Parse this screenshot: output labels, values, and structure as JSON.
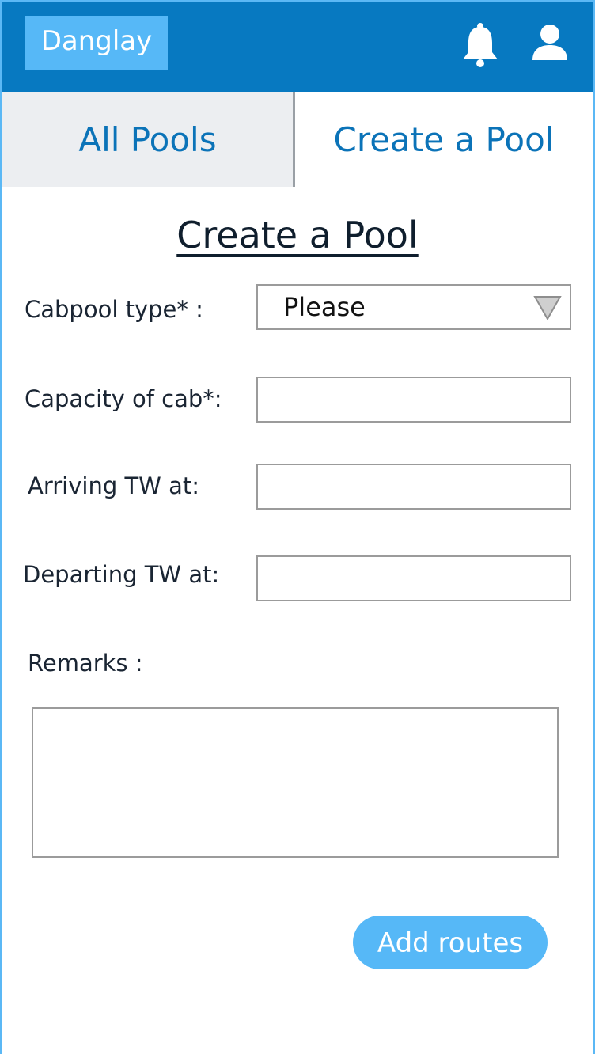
{
  "header": {
    "brand": "Danglay",
    "icons": {
      "notifications": "bell-icon",
      "profile": "user-icon"
    }
  },
  "tabs": [
    {
      "label": "All Pools",
      "active": false
    },
    {
      "label": "Create a Pool",
      "active": true
    }
  ],
  "form": {
    "title": "Create a Pool",
    "cabpool_type": {
      "label": "Cabpool type* :",
      "value": "Please"
    },
    "capacity": {
      "label": "Capacity of cab*:",
      "value": ""
    },
    "arriving": {
      "label": "Arriving TW at:",
      "value": ""
    },
    "departing": {
      "label": "Departing TW at:",
      "value": ""
    },
    "remarks": {
      "label": "Remarks :",
      "value": ""
    },
    "submit_label": "Add routes"
  },
  "colors": {
    "header_bg": "#0779c1",
    "accent": "#56b8f7",
    "tab_text": "#0b73b8",
    "inactive_tab_bg": "#eceef1"
  }
}
